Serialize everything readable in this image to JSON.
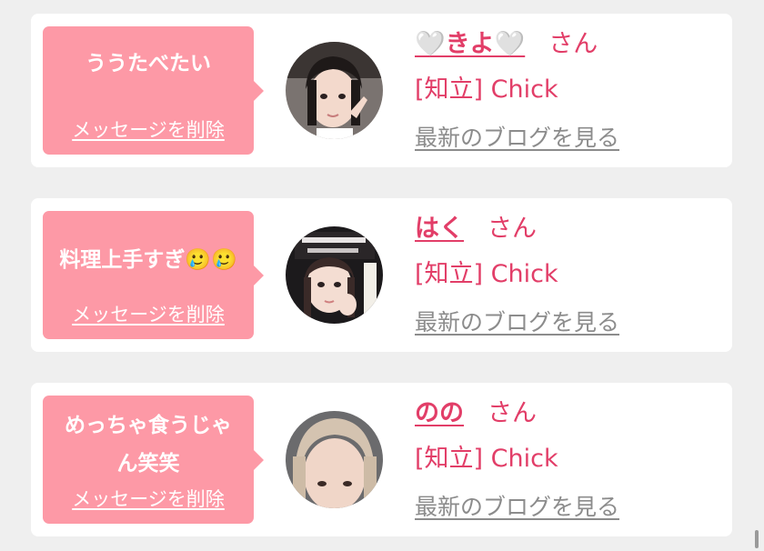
{
  "messages": [
    {
      "message": "ううたべたい",
      "delete_label": "メッセージを削除",
      "name": "🤍きよ🤍",
      "honorific": "さん",
      "group": "[知立] Chick",
      "blog_link": "最新のブログを見る",
      "avatar_icon": "profile-photo"
    },
    {
      "message": "料理上手すぎ🥲🥲",
      "delete_label": "メッセージを削除",
      "name": "はく",
      "honorific": "さん",
      "group": "[知立] Chick",
      "blog_link": "最新のブログを見る",
      "avatar_icon": "profile-photo"
    },
    {
      "message": "めっちゃ食うじゃん笑笑",
      "delete_label": "メッセージを削除",
      "name": "のの",
      "honorific": "さん",
      "group": "[知立] Chick",
      "blog_link": "最新のブログを見る",
      "avatar_icon": "profile-photo"
    }
  ],
  "colors": {
    "accent_pink": "#e23e68",
    "bubble_pink": "#fd99a6",
    "card_bg": "#ffffff",
    "page_bg": "#efefef",
    "link_gray": "#8c8c8c"
  }
}
